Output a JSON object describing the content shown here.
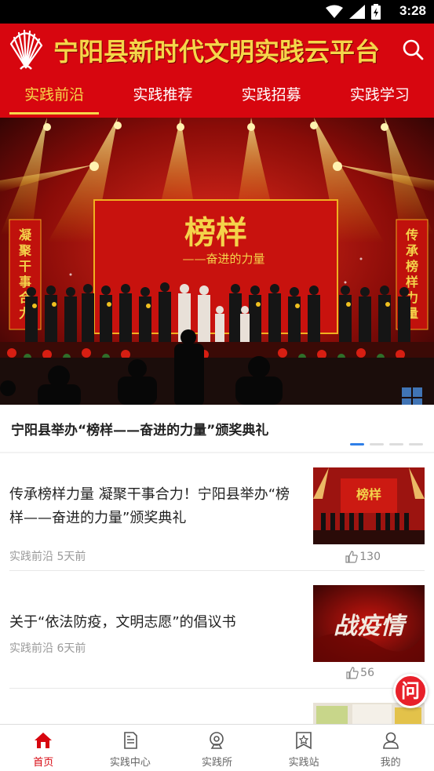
{
  "status_bar": {
    "time": "3:28"
  },
  "header": {
    "title": "宁阳县新时代文明实践云平台"
  },
  "tabs": [
    {
      "label": "实践前沿",
      "active": true
    },
    {
      "label": "实践推荐",
      "active": false
    },
    {
      "label": "实践招募",
      "active": false
    },
    {
      "label": "实践学习",
      "active": false
    }
  ],
  "banner": {
    "caption": "宁阳县举办“榜样——奋进的力量”颁奖典礼",
    "stage_title": "榜样",
    "stage_subtitle": "——奋进的力量",
    "left_banner": "凝聚干事合力",
    "right_banner": "传承榜样力量",
    "slide_count": 4,
    "active_slide": 1
  },
  "articles": [
    {
      "title": "传承榜样力量 凝聚干事合力！宁阳县举办“榜样——奋进的力量”颁奖典礼",
      "category": "实践前沿",
      "time": "5天前",
      "likes": "130",
      "thumb_text": "榜样"
    },
    {
      "title": "关于“依法防疫，文明志愿”的倡议书",
      "category": "实践前沿",
      "time": "6天前",
      "likes": "56",
      "thumb_text": "战疫情"
    }
  ],
  "fab": {
    "label": "问"
  },
  "bottom_nav": [
    {
      "label": "首页",
      "icon": "home-icon",
      "active": true
    },
    {
      "label": "实践中心",
      "icon": "document-icon",
      "active": false
    },
    {
      "label": "实践所",
      "icon": "webcam-icon",
      "active": false
    },
    {
      "label": "实践站",
      "icon": "star-badge-icon",
      "active": false
    },
    {
      "label": "我的",
      "icon": "user-icon",
      "active": false
    }
  ],
  "colors": {
    "brand_red": "#d7060f",
    "title_gold": "#f5d64a",
    "active_dot": "#2f7fe8"
  }
}
